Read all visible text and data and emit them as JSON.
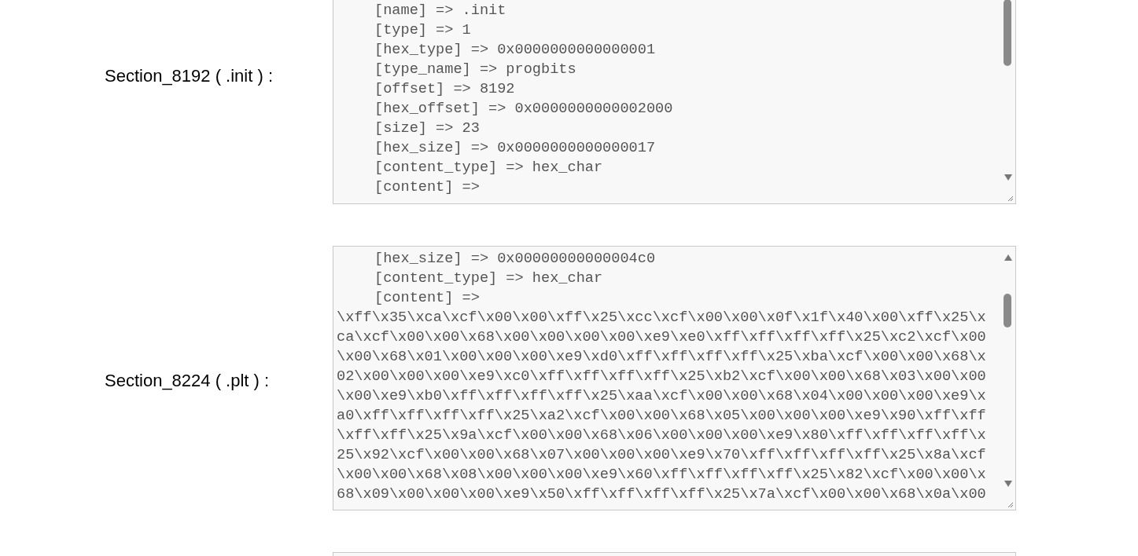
{
  "sections": [
    {
      "label": "Section_8192 ( .init ) :",
      "lines": [
        {
          "kind": "field",
          "text": "[name] => .init"
        },
        {
          "kind": "field",
          "text": "[type] => 1"
        },
        {
          "kind": "field",
          "text": "[hex_type] => 0x0000000000000001"
        },
        {
          "kind": "field",
          "text": "[type_name] => progbits"
        },
        {
          "kind": "field",
          "text": "[offset] => 8192"
        },
        {
          "kind": "field",
          "text": "[hex_offset] => 0x0000000000002000"
        },
        {
          "kind": "field",
          "text": "[size] => 23"
        },
        {
          "kind": "field",
          "text": "[hex_size] => 0x0000000000000017"
        },
        {
          "kind": "field",
          "text": "[content_type] => hex_char"
        },
        {
          "kind": "field",
          "text": "[content] =>"
        }
      ]
    },
    {
      "label": "Section_8224 ( .plt ) :",
      "lines": [
        {
          "kind": "field",
          "text": "[hex_size] => 0x00000000000004c0"
        },
        {
          "kind": "field",
          "text": "[content_type] => hex_char"
        },
        {
          "kind": "field",
          "text": "[content] =>"
        },
        {
          "kind": "data",
          "text": "\\xff\\x35\\xca\\xcf\\x00\\x00\\xff\\x25\\xcc\\xcf\\x00\\x00\\x0f\\x1f\\x40\\x00\\xff\\x25\\x"
        },
        {
          "kind": "data",
          "text": "ca\\xcf\\x00\\x00\\x68\\x00\\x00\\x00\\x00\\xe9\\xe0\\xff\\xff\\xff\\xff\\x25\\xc2\\xcf\\x00"
        },
        {
          "kind": "data",
          "text": "\\x00\\x68\\x01\\x00\\x00\\x00\\xe9\\xd0\\xff\\xff\\xff\\xff\\x25\\xba\\xcf\\x00\\x00\\x68\\x"
        },
        {
          "kind": "data",
          "text": "02\\x00\\x00\\x00\\xe9\\xc0\\xff\\xff\\xff\\xff\\x25\\xb2\\xcf\\x00\\x00\\x68\\x03\\x00\\x00"
        },
        {
          "kind": "data",
          "text": "\\x00\\xe9\\xb0\\xff\\xff\\xff\\xff\\x25\\xaa\\xcf\\x00\\x00\\x68\\x04\\x00\\x00\\x00\\xe9\\x"
        },
        {
          "kind": "data",
          "text": "a0\\xff\\xff\\xff\\xff\\x25\\xa2\\xcf\\x00\\x00\\x68\\x05\\x00\\x00\\x00\\xe9\\x90\\xff\\xff"
        },
        {
          "kind": "data",
          "text": "\\xff\\xff\\x25\\x9a\\xcf\\x00\\x00\\x68\\x06\\x00\\x00\\x00\\xe9\\x80\\xff\\xff\\xff\\xff\\x"
        },
        {
          "kind": "data",
          "text": "25\\x92\\xcf\\x00\\x00\\x68\\x07\\x00\\x00\\x00\\xe9\\x70\\xff\\xff\\xff\\xff\\x25\\x8a\\xcf"
        },
        {
          "kind": "data",
          "text": "\\x00\\x00\\x68\\x08\\x00\\x00\\x00\\xe9\\x60\\xff\\xff\\xff\\xff\\x25\\x82\\xcf\\x00\\x00\\x"
        },
        {
          "kind": "data",
          "text": "68\\x09\\x00\\x00\\x00\\xe9\\x50\\xff\\xff\\xff\\xff\\x25\\x7a\\xcf\\x00\\x00\\x68\\x0a\\x00"
        }
      ]
    }
  ]
}
